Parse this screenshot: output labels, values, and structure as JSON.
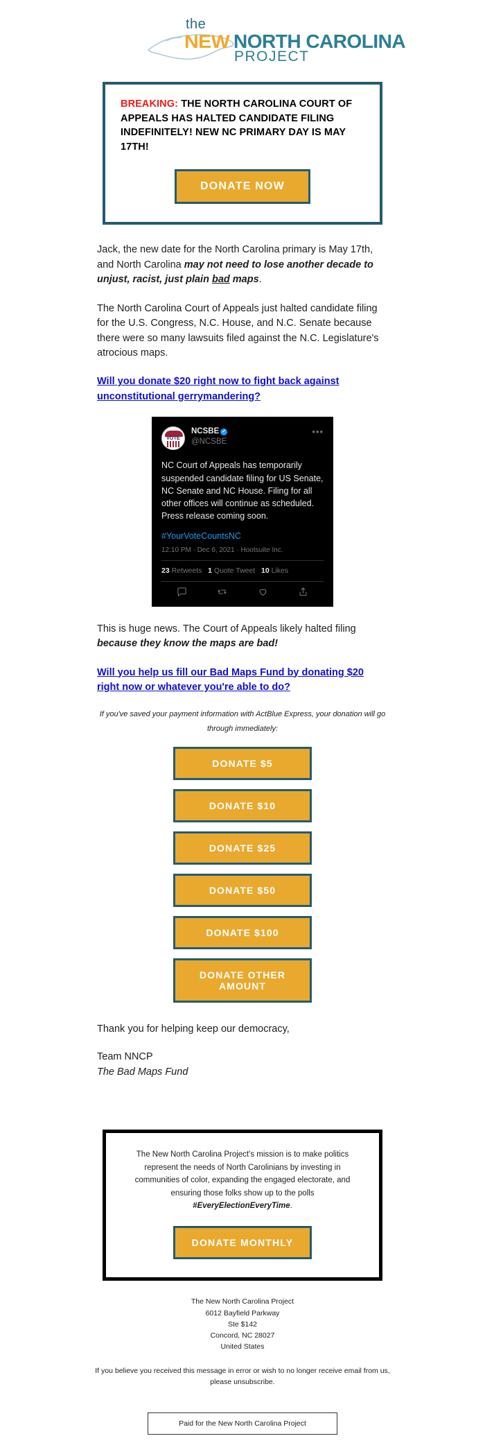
{
  "logo": {
    "the": "the",
    "new": "NEW",
    "state": "NORTH CAROLINA",
    "project": "PROJECT",
    "colors": {
      "gold": "#f0a92c",
      "teal": "#2b7f96"
    }
  },
  "banner": {
    "breaking_label": "BREAKING:",
    "headline": " THE NORTH CAROLINA COURT OF APPEALS HAS HALTED CANDIDATE FILING INDEFINITELY! NEW NC PRIMARY DAY IS MAY 17TH!",
    "donate_button": "DONATE NOW",
    "border_color": "#235c70",
    "breaking_color": "#ee1c1c"
  },
  "body": {
    "para1_a": "Jack, the new date for the North Carolina primary is May 17th, and North Carolina ",
    "para1_bold_a": "may not need to lose another decade to unjust, racist, just plain ",
    "para1_bold_u": "bad",
    "para1_bold_b": " maps",
    "para1_end": ".",
    "para2": "The North Carolina Court of Appeals just halted candidate filing for the U.S. Congress, N.C. House, and N.C. Senate because there were so many lawsuits filed against the N.C. Legislature's atrocious maps.",
    "link1": "Will you donate $20 right now to fight back against unconstitutional gerrymandering?",
    "para3_a": "This is huge news. The Court of Appeals likely halted filing ",
    "para3_bold": "because they know the maps are bad!",
    "link2": "Will you help us fill our Bad Maps Fund by donating $20 right now or whatever you're able to do?",
    "link_color": "#1111cc"
  },
  "tweet": {
    "display_name": "NCSBE",
    "verified_badge": "✓",
    "handle": "@NCSBE",
    "more_icon": "•••",
    "text": "NC Court of Appeals has temporarily suspended candidate filing for US Senate, NC Senate and NC House. Filing for all other offices will continue as scheduled. Press release coming soon.",
    "hashtag": "#YourVoteCountsNC",
    "meta": "12:10 PM · Dec 6, 2021 · Hootsuite Inc.",
    "avatar_text": "VOTE",
    "stats": [
      {
        "count": "23",
        "label": " Retweets"
      },
      {
        "count": "1",
        "label": " Quote Tweet"
      },
      {
        "count": "10",
        "label": " Likes"
      }
    ],
    "actions": [
      "reply-icon",
      "retweet-icon",
      "like-icon",
      "share-icon"
    ]
  },
  "actblue": {
    "note": "If you've saved your payment information with ActBlue Express, your donation will go through immediately:"
  },
  "ladder": {
    "buttons": [
      "DONATE $5",
      "DONATE $10",
      "DONATE $25",
      "DONATE $50",
      "DONATE $100",
      "DONATE OTHER AMOUNT"
    ],
    "button_bg": "#e9a92e",
    "button_border": "#235c70"
  },
  "signoff": {
    "thanks": "Thank you for helping keep our democracy,",
    "team": "Team NNCP",
    "fund": "The Bad Maps Fund"
  },
  "mission": {
    "text_a": "The New North Carolina Project's mission is to make politics represent the needs of North Carolinians by investing in communities of color, expanding the engaged electorate, and ensuring those folks show up to the polls ",
    "hashtag": "#EveryElectionEveryTime",
    "text_b": ".",
    "button": "DONATE MONTHLY"
  },
  "footer": {
    "address": [
      "The New North Carolina Project",
      "6012 Bayfield Parkway",
      "Ste $142",
      "Concord, NC 28027",
      "United States"
    ],
    "unsubscribe": "If you believe you received this message in error or wish to no longer receive email from us, please unsubscribe.",
    "paid_for": "Paid for the New North Carolina Project"
  }
}
